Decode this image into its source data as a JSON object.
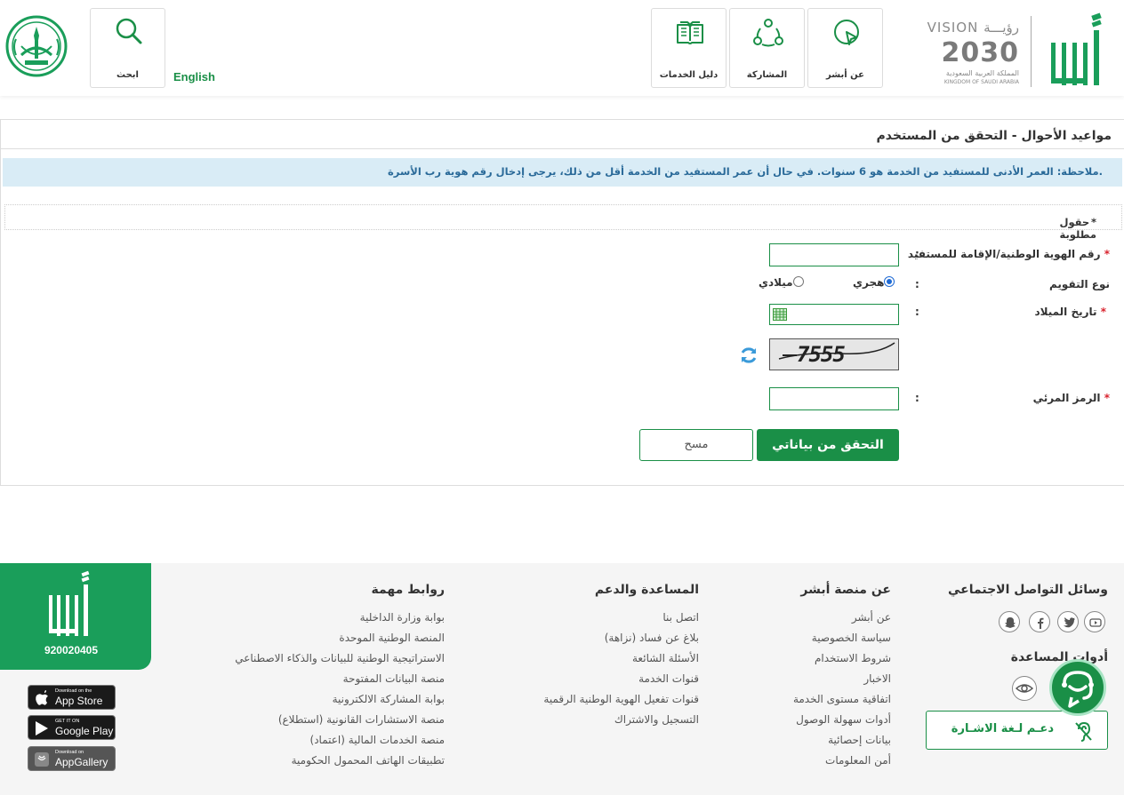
{
  "header": {
    "vision": {
      "title_ar": "رؤيـــة",
      "title_en": "VISION",
      "year": "2030",
      "kingdom_ar": "المملكة العربية السعودية",
      "kingdom_en": "KINGDOM OF SAUDI ARABIA"
    },
    "nav": [
      {
        "label": "عن أبشر",
        "icon": "cursor-icon"
      },
      {
        "label": "المشاركة",
        "icon": "share-icon"
      },
      {
        "label": "دليل الخدمات",
        "icon": "book-icon"
      }
    ],
    "language_link": "English",
    "search_label": "ابحث"
  },
  "main": {
    "title": "مواعيد الأحوال - التحقق من المستخدم",
    "note": "ملاحظة: العمر الأدنى للمستفيد من الخدمة هو 6 سنوات. في حال أن عمر المستفيد من الخدمة أقل من ذلك، يرجى إدخال رقم هوية رب الأسرة.",
    "required_fields": "حقول مطلوبة",
    "fields": {
      "id_label": "رقم الهوية الوطنية/الإقامة للمستفيد",
      "calendar_label": "نوع التقويم",
      "hijri": "هجري",
      "gregorian": "ميلادي",
      "dob_label": "تاريخ الميلاد",
      "captcha_text": "7555",
      "captcha_label": "الرمز المرئي",
      "colon": ":",
      "star": "*"
    },
    "buttons": {
      "verify": "التحقق من بياناتي",
      "clear": "مسح"
    }
  },
  "footer": {
    "phone": "920020405",
    "stores": [
      {
        "small": "Download on the",
        "big": "App Store"
      },
      {
        "small": "GET IT ON",
        "big": "Google Play"
      },
      {
        "small": "Download on",
        "big": "AppGallery"
      }
    ],
    "social_title": "وسائل التواصل الاجتماعي",
    "tools_title": "أدوات المساعدة",
    "sign_language": "دعـم لـغة الاشـارة",
    "about": {
      "title": "عن منصة أبشر",
      "links": [
        "عن أبشر",
        "سياسة الخصوصية",
        "شروط الاستخدام",
        "الاخبار",
        "اتفاقية مستوى الخدمة",
        "أدوات سهولة الوصول",
        "بيانات إحصائية",
        "أمن المعلومات"
      ]
    },
    "support": {
      "title": "المساعدة والدعم",
      "links": [
        "اتصل بنا",
        "بلاغ عن فساد (نزاهة)",
        "الأسئلة الشائعة",
        "قنوات الخدمة",
        "قنوات تفعيل الهوية الوطنية الرقمية",
        "التسجيل والاشتراك"
      ]
    },
    "important": {
      "title": "روابط مهمة",
      "links": [
        "بوابة وزارة الداخلية",
        "المنصة الوطنية الموحدة",
        "الاستراتيجية الوطنية للبيانات والذكاء الاصطناعي",
        "منصة البيانات المفتوحة",
        "بوابة المشاركة الالكترونية",
        "منصة الاستشارات القانونية (استطلاع)",
        "منصة الخدمات المالية (اعتماد)",
        "تطبيقات الهاتف المحمول الحكومية"
      ]
    }
  },
  "colors": {
    "brand_green": "#1a8f47",
    "note_bg": "#d9ecf6",
    "note_text": "#2a6a99",
    "required_star": "#d9232e"
  }
}
